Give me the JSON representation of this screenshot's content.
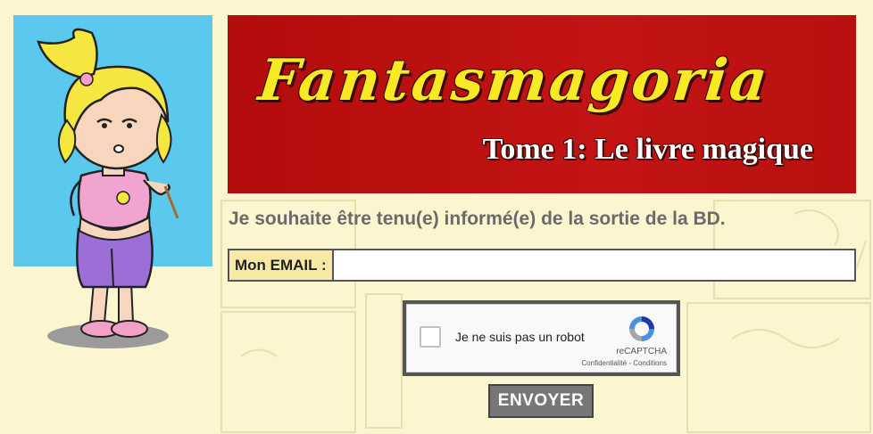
{
  "banner": {
    "title": "Fantasmagoria",
    "subtitle": "Tome 1: Le livre magique"
  },
  "form": {
    "heading": "Je souhaite être tenu(e) informé(e) de la sortie de la BD.",
    "email_label": "Mon EMAIL :",
    "email_value": "",
    "submit_label": "ENVOYER"
  },
  "captcha": {
    "checkbox_label": "Je ne suis pas un robot",
    "brand": "reCAPTCHA",
    "terms": "Confidentialité - Conditions",
    "checked": false
  },
  "colors": {
    "background": "#fbf6cf",
    "banner_red": "#b30c0c",
    "title_yellow": "#f7ea24",
    "label_bg": "#f6e9a6",
    "button_gray": "#777777",
    "sky_blue": "#5bc9ee"
  },
  "icons": {
    "captcha": "recaptcha-logo-icon",
    "illustration": "cartoon-girl-illustration"
  }
}
